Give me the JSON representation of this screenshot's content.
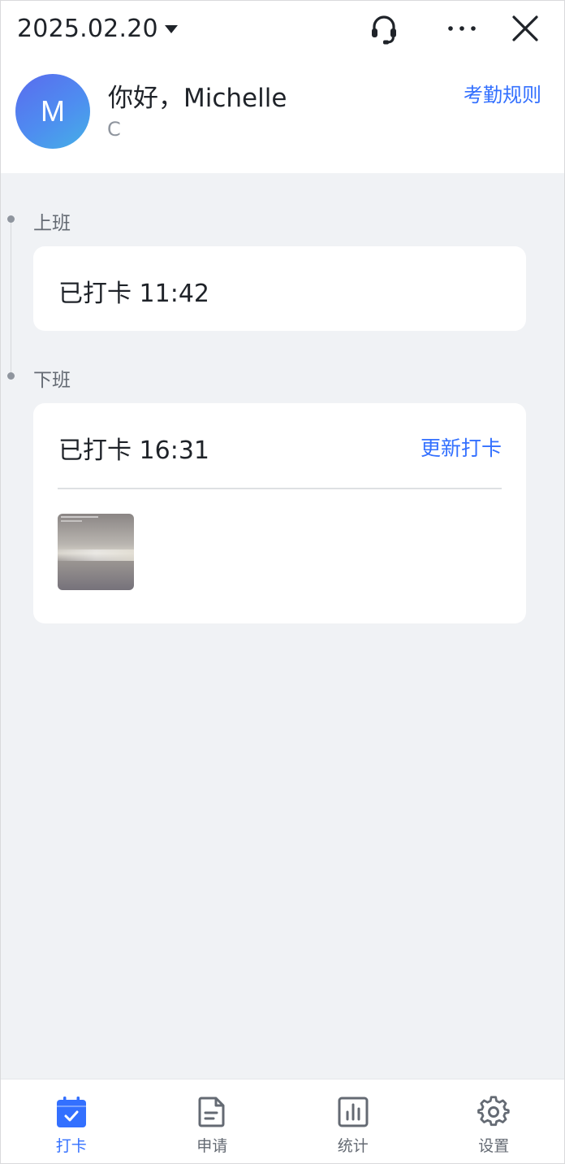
{
  "header": {
    "date": "2025.02.20",
    "greeting": "你好，Michelle",
    "subtitle": "C",
    "avatar_initial": "M",
    "rules_link": "考勤规则",
    "icons": [
      "headset-icon",
      "more-icon",
      "close-icon"
    ]
  },
  "shifts": [
    {
      "label": "上班",
      "status": "已打卡 11:42"
    },
    {
      "label": "下班",
      "status": "已打卡 16:31",
      "action": "更新打卡",
      "has_photo": true
    }
  ],
  "tabbar": {
    "active": 0,
    "tabs": [
      {
        "label": "打卡",
        "icon": "calendar-check-icon"
      },
      {
        "label": "申请",
        "icon": "document-icon"
      },
      {
        "label": "统计",
        "icon": "bar-chart-icon"
      },
      {
        "label": "设置",
        "icon": "gear-icon"
      }
    ]
  },
  "colors": {
    "accent": "#3370ff",
    "background": "#f0f2f5",
    "text_primary": "#1f2329",
    "text_secondary": "#646a73"
  }
}
